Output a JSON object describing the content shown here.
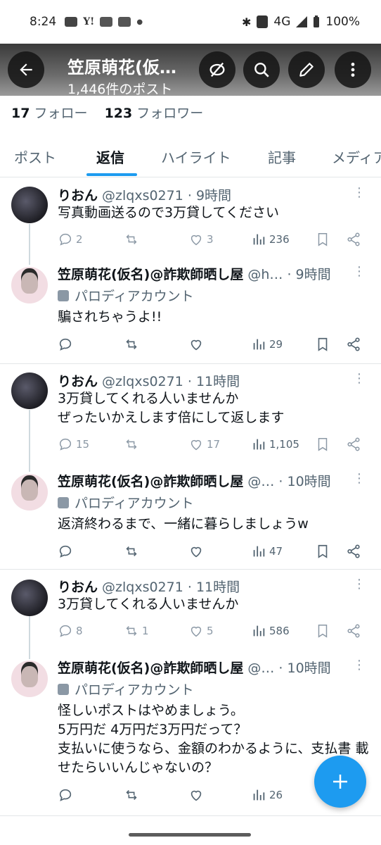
{
  "status_bar": {
    "time": "8:24",
    "network": "4G",
    "battery": "100%"
  },
  "header": {
    "title": "笠原萌花(仮…",
    "subtitle": "1,446件のポスト"
  },
  "profile": {
    "following_count": "17",
    "following_label": "フォロー",
    "followers_count": "123",
    "followers_label": "フォロワー"
  },
  "tabs": [
    "ポスト",
    "返信",
    "ハイライト",
    "記事",
    "メディア"
  ],
  "active_tab": "返信",
  "threads": [
    {
      "reply": {
        "name": "りおん",
        "meta": "@zlqxs0271 · 9時間",
        "text": "写真動画送るので3万貸してください",
        "replies": "2",
        "reposts": "",
        "likes": "3",
        "views": "236"
      },
      "answer": {
        "name": "笠原萌花(仮名)@詐欺師晒し屋",
        "meta": "@h… · 9時間",
        "parody": "パロディアカウント",
        "text": "騙されちゃうよ!!",
        "views": "29"
      }
    },
    {
      "reply": {
        "name": "りおん",
        "meta": "@zlqxs0271 · 11時間",
        "text": "3万貸してくれる人いませんか\nぜったいかえします倍にして返します",
        "replies": "15",
        "reposts": "",
        "likes": "17",
        "views": "1,105"
      },
      "answer": {
        "name": "笠原萌花(仮名)@詐欺師晒し屋",
        "meta": "@… · 10時間",
        "parody": "パロディアカウント",
        "text": "返済終わるまで、一緒に暮らしましょうw",
        "views": "47"
      }
    },
    {
      "reply": {
        "name": "りおん",
        "meta": "@zlqxs0271 · 11時間",
        "text": "3万貸してくれる人いませんか",
        "replies": "8",
        "reposts": "1",
        "likes": "5",
        "views": "586"
      },
      "answer": {
        "name": "笠原萌花(仮名)@詐欺師晒し屋",
        "meta": "@… · 10時間",
        "parody": "パロディアカウント",
        "text": "怪しいポストはやめましょう。\n5万円だ 4万円だ3万円だって？\n支払いに使うなら、金額のわかるように、支払書 載せたらいいんじゃないの？",
        "views": "26"
      }
    }
  ],
  "icons": {
    "back": "back-arrow-icon",
    "hide": "eye-slash-icon",
    "search": "search-icon",
    "edit": "pencil-icon",
    "menu": "kebab-menu-icon",
    "compose": "plus-icon"
  },
  "colors": {
    "accent": "#1d9bf0",
    "text": "#0f1419",
    "muted": "#536471"
  }
}
